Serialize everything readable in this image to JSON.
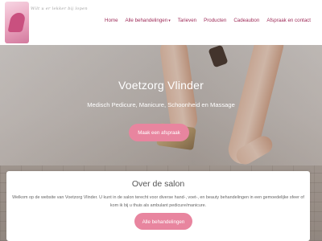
{
  "brand": {
    "logo_text": "Wilt u er lekker bij lopen",
    "logo_icon": "high-heel-shoe-logo"
  },
  "nav": {
    "items": [
      {
        "label": "Home"
      },
      {
        "label": "Alle behandelingen"
      },
      {
        "label": "Tarieven"
      },
      {
        "label": "Producten"
      },
      {
        "label": "Cadeaubon"
      },
      {
        "label": "Afspraak en contact"
      }
    ],
    "dropdown_caret": "▾"
  },
  "hero": {
    "title": "Voetzorg Vlinder",
    "subtitle": "Medisch Pedicure, Manicure, Schoonheid en Massage",
    "button_label": "Maak een afspraak"
  },
  "about": {
    "title": "Over de salon",
    "text": "Welkom op de website van Voetzorg Vlinder. U kunt in de salon terecht voor diverse hand-, voet-, en beauty behandelingen in een gemoedelijke sfeer of kom ik bij u thuis als ambulant pedicure/manicure.",
    "button_label": "Alle behandelingen"
  },
  "colors": {
    "accent": "#9e2b58",
    "button": "#e8859f"
  }
}
